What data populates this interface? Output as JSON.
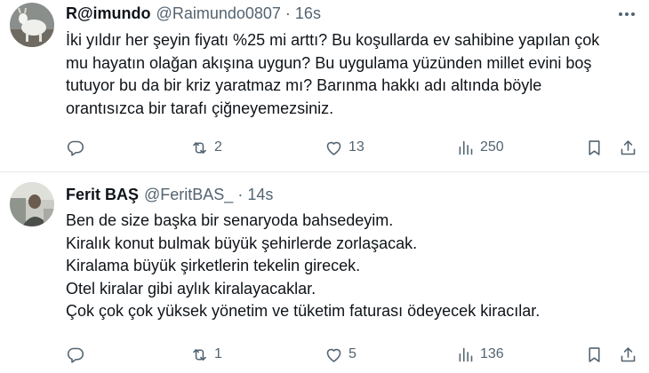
{
  "tweets": [
    {
      "name": "R@imundo",
      "handle": "@Raimundo0807",
      "dot": "·",
      "time": "16s",
      "lines": [
        "İki yıldır her şeyin fiyatı %25 mi arttı? Bu koşullarda ev sahibine yapılan çok",
        "mu hayatın olağan akışına uygun? Bu uygulama yüzünden millet evini boş",
        "tutuyor bu da bir kriz yaratmaz mı? Barınma hakkı adı altında böyle",
        "orantısızca bir tarafı çiğneyemezsiniz."
      ],
      "stats": {
        "reposts": "2",
        "likes": "13",
        "views": "250"
      }
    },
    {
      "name": "Ferit BAŞ",
      "handle": "@FeritBAS_",
      "dot": "·",
      "time": "14s",
      "lines": [
        "Ben de size başka bir senaryoda bahsedeyim.",
        "Kiralık konut bulmak büyük şehirlerde zorlaşacak.",
        "Kiralama büyük şirketlerin tekelin girecek.",
        "Otel kiralar gibi aylık kiralayacaklar.",
        "Çok çok çok yüksek yönetim ve tüketim faturası ödeyecek kiracılar."
      ],
      "stats": {
        "reposts": "1",
        "likes": "5",
        "views": "136"
      }
    }
  ],
  "icons": {
    "reply": "reply-icon",
    "repost": "repost-icon",
    "like": "heart-icon",
    "views": "views-icon",
    "bookmark": "bookmark-icon",
    "share": "share-icon",
    "more": "more-icon"
  },
  "colors": {
    "text": "#0f1419",
    "secondary": "#536471",
    "divider": "#e6e9ec",
    "background": "#ffffff"
  }
}
